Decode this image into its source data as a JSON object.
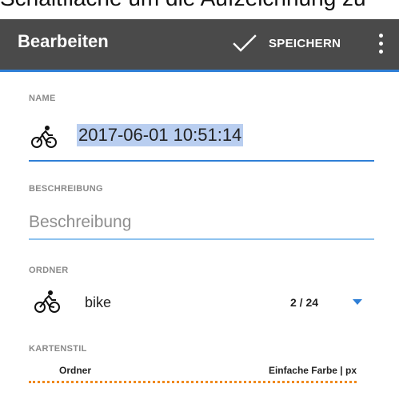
{
  "caption": {
    "text": "Schaltfläche um die Aufzeichnung zu"
  },
  "appbar": {
    "title": "Bearbeiten",
    "save_label": "SPEICHERN",
    "background": "#4a4a4a",
    "accent": "#2f7fd6"
  },
  "name": {
    "label": "NAME",
    "value": "2017-06-01 10:51:14",
    "icon": "bike-icon"
  },
  "description": {
    "label": "BESCHREIBUNG",
    "placeholder": "Beschreibung"
  },
  "folder": {
    "label": "ORDNER",
    "name": "bike",
    "count": "2 / 24",
    "icon": "bike-icon"
  },
  "map_style": {
    "label": "KARTENSTIL",
    "left_text": "Ordner",
    "right_text": "Einfache Farbe | px",
    "line_color": "#f08a1c"
  }
}
